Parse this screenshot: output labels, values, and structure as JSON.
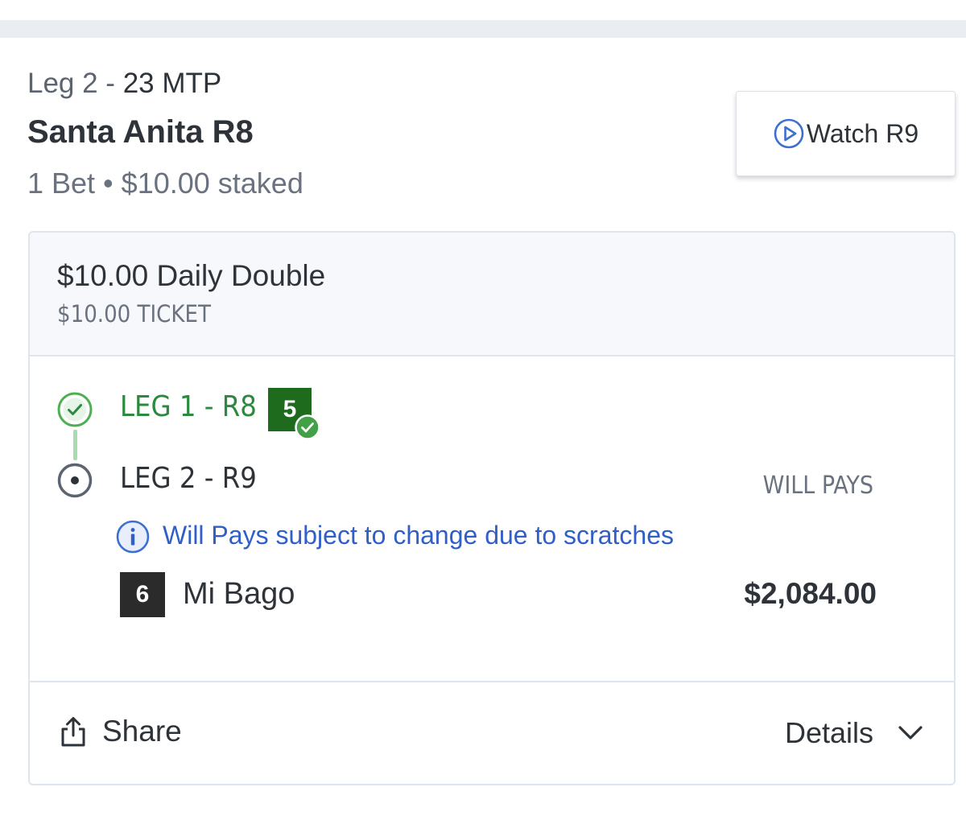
{
  "header": {
    "leg_prefix": "Leg 2 - ",
    "mtp": "23 MTP",
    "track_race": "Santa Anita R8",
    "summary": "1 Bet • $10.00 staked",
    "watch_label": "Watch R9",
    "watch_icon": "play-circle-icon"
  },
  "bet": {
    "title": "$10.00 Daily Double",
    "ticket": "$10.00 TICKET",
    "legs": [
      {
        "label": "LEG 1 - R8",
        "status": "complete",
        "icon": "check-circle-icon",
        "pick_number": "5",
        "pick_status": "winner"
      },
      {
        "label": "LEG 2 - R9",
        "status": "current",
        "icon": "radio-dot-icon"
      }
    ],
    "will_pays_header": "WILL PAYS",
    "info_text": "Will Pays subject to change due to scratches",
    "runner": {
      "number": "6",
      "name": "Mi Bago",
      "payout": "$2,084.00"
    }
  },
  "footer": {
    "share_label": "Share",
    "details_label": "Details"
  },
  "colors": {
    "win_green": "#2b8a3e",
    "badge_green": "#1e6b1e",
    "link_blue": "#2f5fc7",
    "text_dark": "#2d3338"
  }
}
